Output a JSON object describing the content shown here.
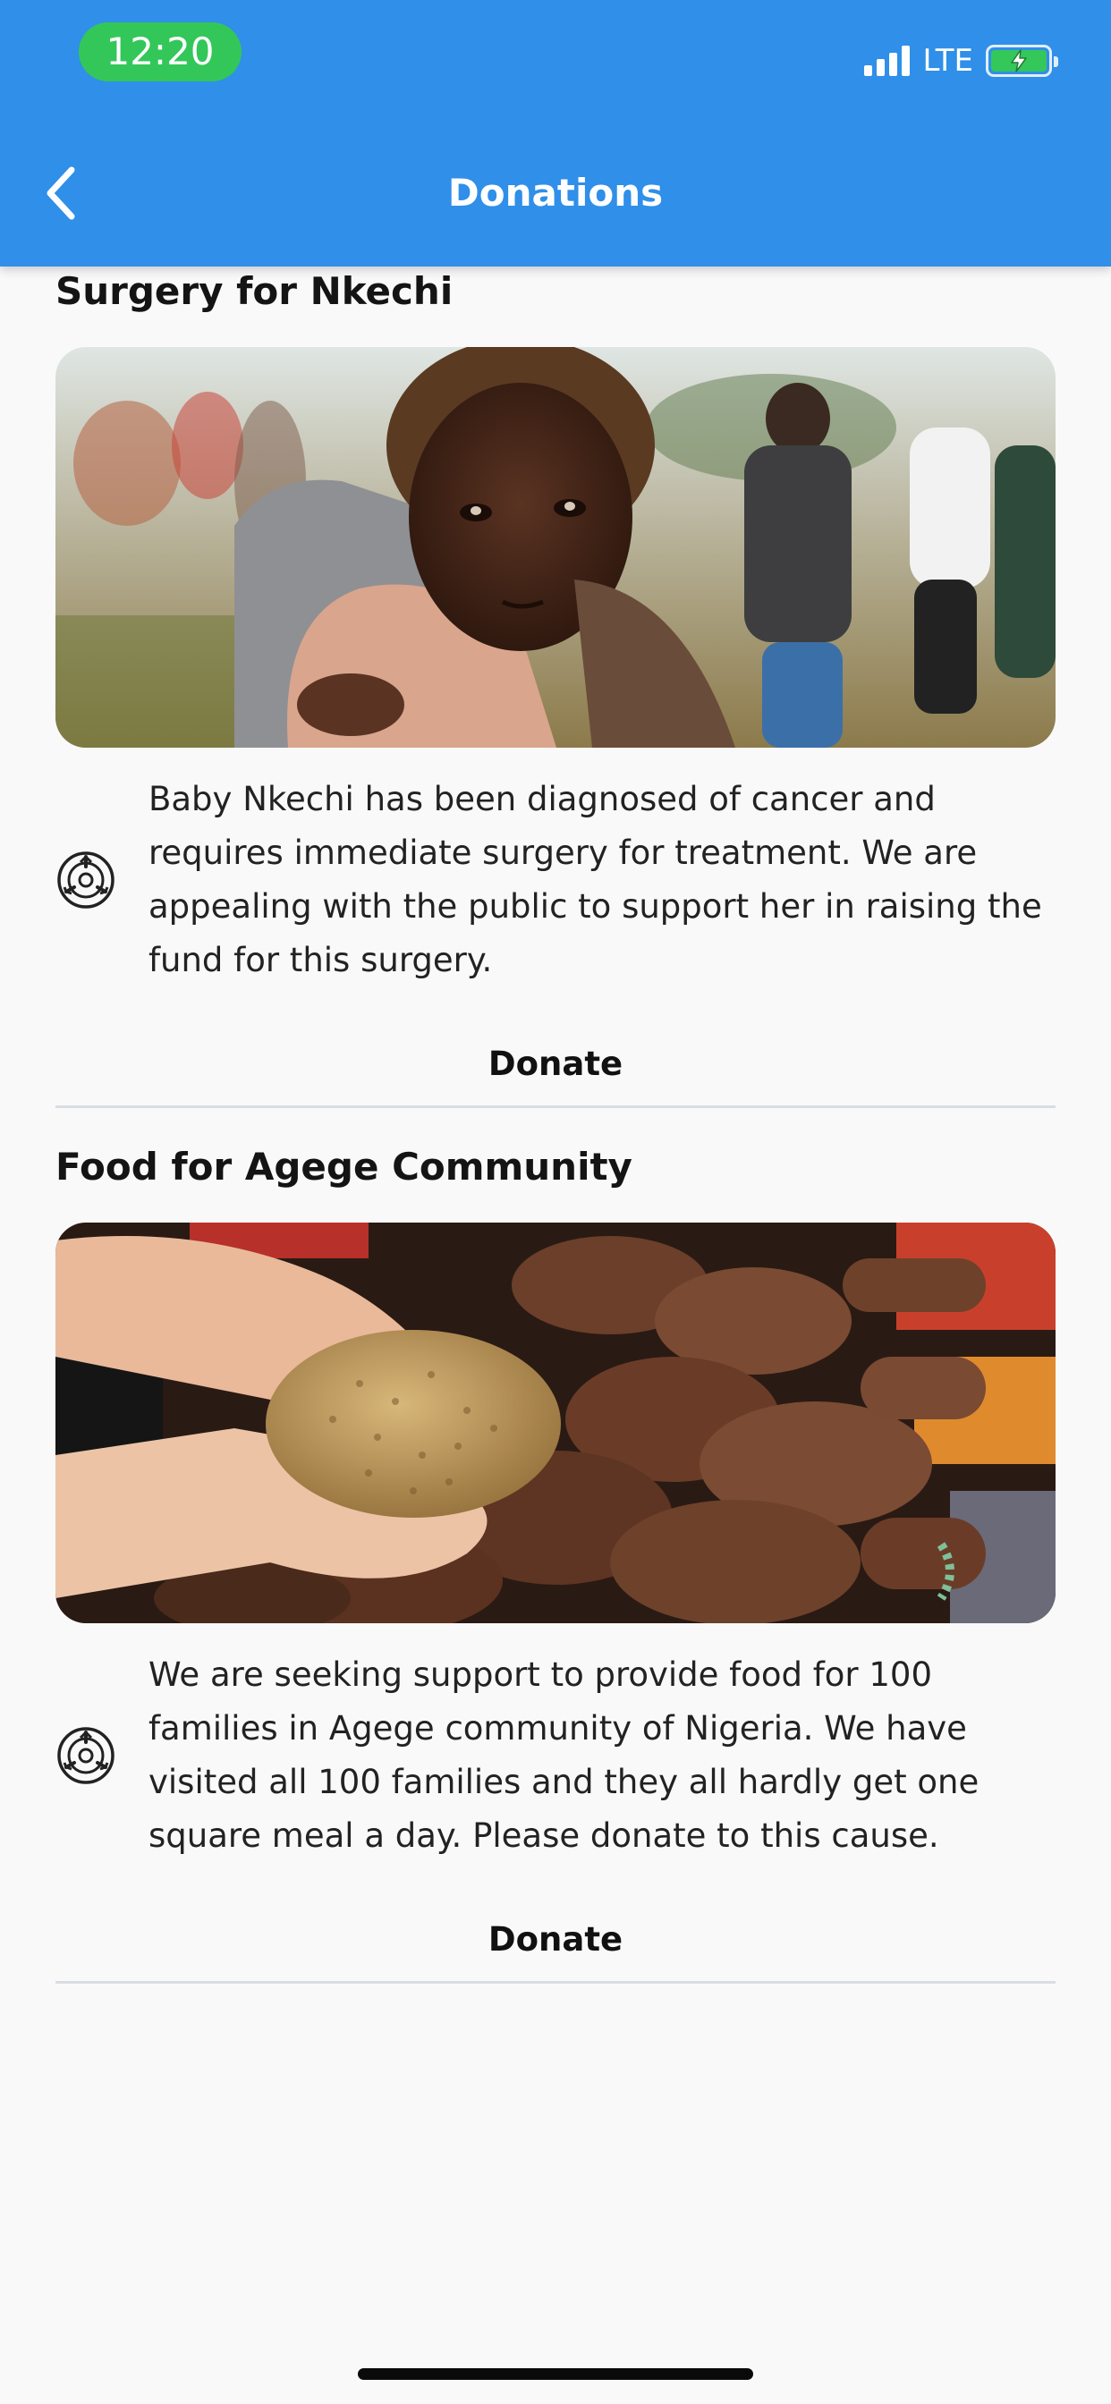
{
  "status_bar": {
    "time": "12:20",
    "network": "LTE",
    "battery_level": 1.0,
    "charging": true
  },
  "header": {
    "title": "Donations",
    "back_icon": "chevron-left-icon",
    "background": "#2f8fe9"
  },
  "donations": [
    {
      "title": "Surgery for Nkechi",
      "image": "photo of a young child resting on an adult's shoulder",
      "icon": "emblem-icon",
      "description": "Baby Nkechi has been diagnosed of cancer and requires immediate surgery for treatment. We are appealing with the public to support her in raising the fund for this surgery.",
      "donate_label": "Donate"
    },
    {
      "title": "Food for Agege Community",
      "image": "photo of hands holding grain with many outstretched hands",
      "icon": "emblem-icon",
      "description": "We are seeking support to provide food for 100 families in Agege community of Nigeria. We have visited all 100 families and they all hardly get one square meal a day. Please donate to this cause.",
      "donate_label": "Donate"
    }
  ]
}
